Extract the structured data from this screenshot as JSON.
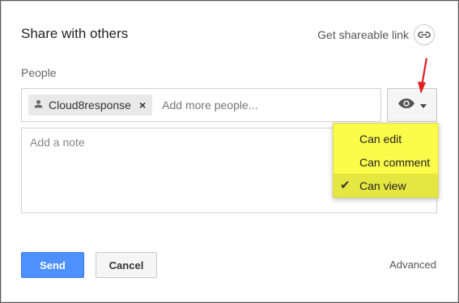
{
  "dialog": {
    "title": "Share with others",
    "share_link_label": "Get shareable link"
  },
  "people": {
    "label": "People",
    "chip_name": "Cloud8response",
    "chip_close": "×",
    "input_placeholder": "Add more people..."
  },
  "permission_menu": {
    "items": [
      {
        "label": "Can edit"
      },
      {
        "label": "Can comment"
      },
      {
        "label": "Can view",
        "selected": true
      }
    ],
    "check_mark": "✔"
  },
  "note": {
    "placeholder": "Add a note"
  },
  "footer": {
    "send_label": "Send",
    "cancel_label": "Cancel",
    "advanced_label": "Advanced"
  },
  "colors": {
    "highlight": "#fbfb4a",
    "send_button": "#4d90fe",
    "annotation_arrow": "#e02020"
  },
  "icons": {
    "person": "person-icon",
    "link": "link-icon",
    "eye": "eye-icon",
    "dropdown": "chevron-down-icon"
  }
}
